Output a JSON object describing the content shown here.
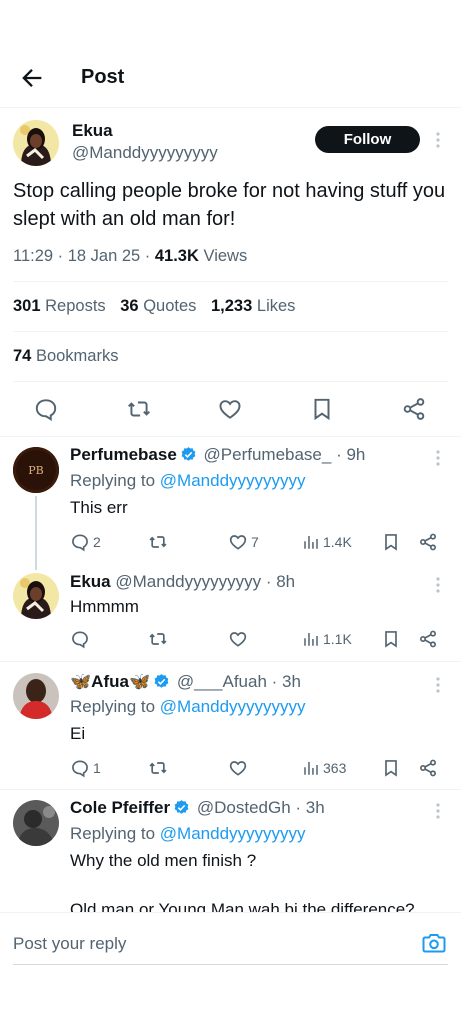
{
  "header": {
    "title": "Post"
  },
  "tweet": {
    "name": "Ekua",
    "handle": "@Manddyyyyyyyyy",
    "follow_label": "Follow",
    "text": "Stop calling people broke for not having stuff you slept with an old man for!",
    "time": "11:29 · 18 Jan 25 · ",
    "views": "41.3K",
    "views_label": " Views",
    "reposts": "301",
    "reposts_label": "Reposts",
    "quotes": "36",
    "quotes_label": "Quotes",
    "likes": "1,233",
    "likes_label": "Likes",
    "bookmarks": "74",
    "bookmarks_label": "Bookmarks"
  },
  "replies": [
    {
      "name": "Perfumebase",
      "verified": true,
      "handle": "@Perfumebase_",
      "time": " · 9h",
      "replying_prefix": "Replying to ",
      "replying_to": "@Manddyyyyyyyyy",
      "text": "This err",
      "comments": "2",
      "reposts": "",
      "likes": "7",
      "views": "1.4K"
    },
    {
      "name": "Ekua",
      "verified": false,
      "handle": "@Manddyyyyyyyyy",
      "time": " · 8h",
      "text": "Hmmmm",
      "comments": "",
      "reposts": "",
      "likes": "",
      "views": "1.1K"
    },
    {
      "name": "🦋Afua🦋",
      "verified": true,
      "handle": "@___Afuah",
      "time": " · 3h",
      "replying_prefix": "Replying to ",
      "replying_to": "@Manddyyyyyyyyy",
      "text": "Ei",
      "comments": "1",
      "reposts": "",
      "likes": "",
      "views": "363"
    },
    {
      "name": "Cole Pfeiffer",
      "verified": true,
      "handle": "@DostedGh",
      "time": " · 3h",
      "replying_prefix": "Replying to ",
      "replying_to": "@Manddyyyyyyyyy",
      "text": "Why the old men finish ?",
      "text2": "Old man or Young Man wah bi the difference?"
    }
  ],
  "reply_bar": {
    "placeholder": "Post your reply"
  },
  "colors": {
    "accent": "#1d9bf0",
    "text": "#0f1419",
    "muted": "#536471",
    "divider": "#eff3f4"
  }
}
